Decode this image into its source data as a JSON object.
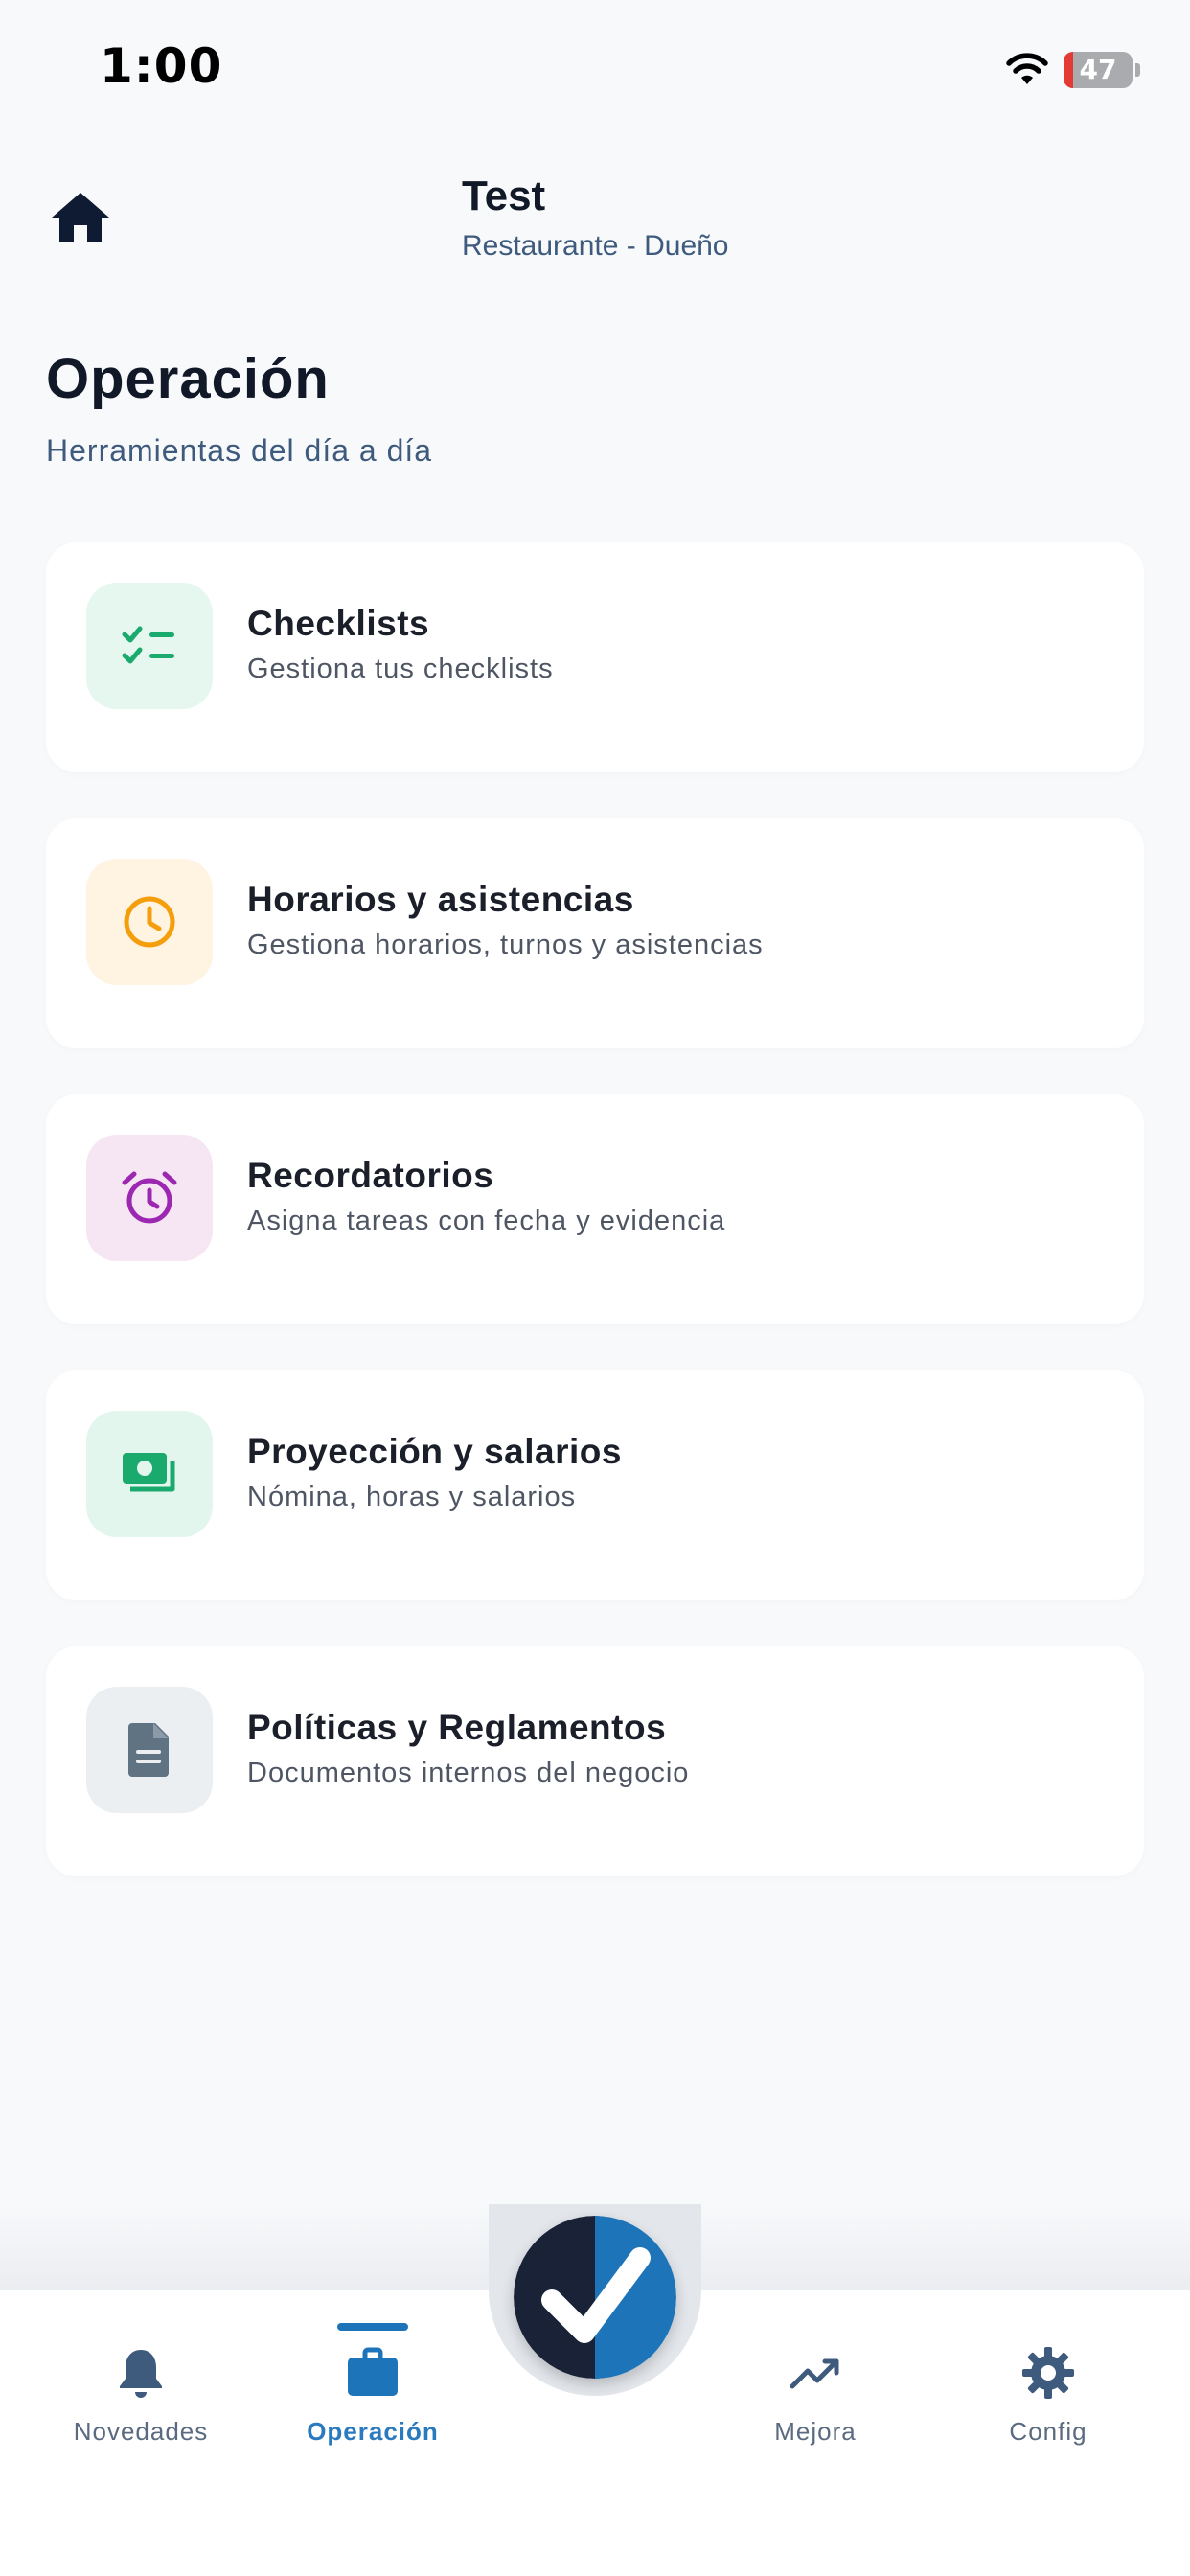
{
  "status_bar": {
    "time": "1:00",
    "battery_level": "47"
  },
  "header": {
    "title": "Test",
    "subtitle": "Restaurante - Dueño"
  },
  "page": {
    "title": "Operación",
    "subtitle": "Herramientas del día a día"
  },
  "cards": [
    {
      "title": "Checklists",
      "subtitle": "Gestiona tus checklists",
      "icon": "checklist-icon",
      "color": "#1aaa6e",
      "bg": "#e6f7ef"
    },
    {
      "title": "Horarios y asistencias",
      "subtitle": "Gestiona horarios, turnos y asistencias",
      "icon": "clock-icon",
      "color": "#f59e0b",
      "bg": "#fff3e2"
    },
    {
      "title": "Recordatorios",
      "subtitle": "Asigna tareas con fecha y evidencia",
      "icon": "alarm-clock-icon",
      "color": "#9c27b0",
      "bg": "#f6e6f4"
    },
    {
      "title": "Proyección y salarios",
      "subtitle": "Nómina, horas y salarios",
      "icon": "money-icon",
      "color": "#1aaa6e",
      "bg": "#e3f6ee"
    },
    {
      "title": "Políticas y Reglamentos",
      "subtitle": "Documentos internos del negocio",
      "icon": "document-icon",
      "color": "#5f7383",
      "bg": "#eceff2"
    }
  ],
  "nav": {
    "items": [
      {
        "label": "Novedades",
        "icon": "bell-icon"
      },
      {
        "label": "Operación",
        "icon": "briefcase-icon",
        "active": true
      },
      {
        "label": "Mejora",
        "icon": "trending-up-icon"
      },
      {
        "label": "Config",
        "icon": "gear-icon"
      }
    ],
    "fab_icon": "checkmark-logo-icon"
  },
  "colors": {
    "accent": "#1e74b8",
    "navy": "#1a2238",
    "text_muted": "#3e5a7c"
  }
}
